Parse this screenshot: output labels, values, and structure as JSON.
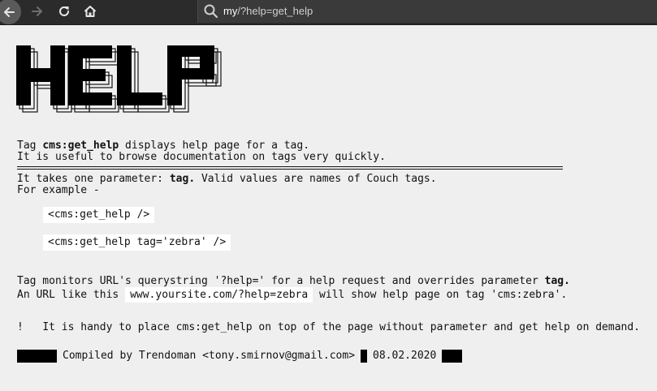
{
  "browser": {
    "url_host": "my",
    "url_rest": "/?help=get_help",
    "icons": [
      "back-arrow-icon",
      "forward-arrow-icon",
      "reload-icon",
      "home-icon",
      "search-icon"
    ]
  },
  "banner": {
    "text": "HELP"
  },
  "intro": {
    "l1_pre": "Tag ",
    "l1_tag": "cms:get_help",
    "l1_post": " displays help page for a tag.",
    "l2": "It is useful to browse documentation on tags very quickly."
  },
  "params": {
    "l1_pre": "It takes one parameter: ",
    "l1_param": "tag.",
    "l1_post": " Valid values are names of Couch tags.",
    "l2": "For example -"
  },
  "examples": [
    "<cms:get_help />",
    "<cms:get_help tag='zebra' />"
  ],
  "monitor": {
    "l1_pre": "Tag monitors URL's querystring '?help=' for a help request and overrides parameter ",
    "l1_param": "tag.",
    "l2_pre": "An URL like this ",
    "l2_url": "www.yoursite.com/?help=zebra",
    "l2_post": " will show help page on tag 'cms:zebra'."
  },
  "tip": {
    "mark": "!",
    "text": "It is handy to place cms:get_help on top of the page without parameter and get help on demand."
  },
  "footer": {
    "compiled": "Compiled by Trendoman <tony.smirnov@gmail.com>",
    "date": "08.02.2020"
  }
}
